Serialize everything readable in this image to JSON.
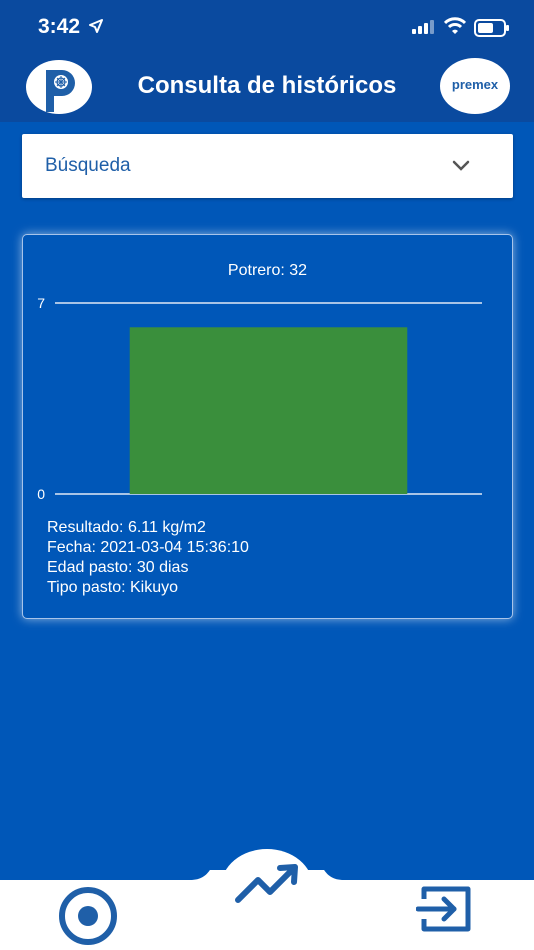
{
  "status": {
    "time": "3:42"
  },
  "header": {
    "title": "Consulta de históricos",
    "brand": "premex"
  },
  "search": {
    "label": "Búsqueda"
  },
  "chart": {
    "title": "Potrero: 32",
    "bar_color": "#3a8f3c",
    "info": {
      "resultado": "Resultado: 6.11 kg/m2",
      "fecha": "Fecha: 2021-03-04 15:36:10",
      "edad": "Edad pasto: 30 dias",
      "tipo": "Tipo pasto: Kikuyo"
    }
  },
  "chart_data": {
    "type": "bar",
    "categories": [
      ""
    ],
    "values": [
      6.11
    ],
    "title": "Potrero: 32",
    "xlabel": "",
    "ylabel": "",
    "ylim": [
      0,
      7
    ],
    "yticks": [
      "0",
      "7"
    ]
  },
  "colors": {
    "background": "#0057b8",
    "header": "#0a4a9f",
    "bar": "#3a8f3c",
    "accent": "#1f5fa8"
  }
}
